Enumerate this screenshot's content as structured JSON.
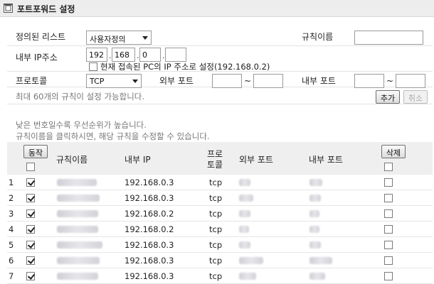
{
  "title": "포트포워드 설정",
  "form": {
    "defined_list_label": "정의된 리스트",
    "defined_list_value": "사용자정의",
    "rule_name_label": "규칙이름",
    "rule_name_value": "",
    "internal_ip_label": "내부 IP주소",
    "ip1": "192",
    "ip2": "168",
    "ip3": "0",
    "ip4": "",
    "use_current_pc_label": "현재 접속된 PC의 IP 주소로 설정(192.168.0.2)",
    "protocol_label": "프로토콜",
    "protocol_value": "TCP",
    "external_port_label": "외부 포트",
    "external_port_from": "",
    "external_port_to": "",
    "internal_port_label": "내부 포트",
    "internal_port_from": "",
    "internal_port_to": "",
    "tilde": "~",
    "max_rules_note": "최대 60개의 규칙이 설정 가능합니다.",
    "add_label": "추가",
    "cancel_label": "취소"
  },
  "notes": {
    "priority_note": "낮은 번호일수록 우선순위가 높습니다.",
    "edit_note": "규칙이름을 클릭하시면, 해당 규칙을 수정할 수 있습니다."
  },
  "table": {
    "action_btn": "동작",
    "col_rule_name": "규칙이름",
    "col_internal_ip": "내부 IP",
    "col_protocol_1": "프로",
    "col_protocol_2": "토콜",
    "col_external_port": "외부 포트",
    "col_internal_port": "내부 포트",
    "delete_btn": "삭제",
    "rows": [
      {
        "num": "1",
        "ip": "192.168.0.3",
        "proto": "tcp",
        "active": true,
        "delete": false
      },
      {
        "num": "2",
        "ip": "192.168.0.3",
        "proto": "tcp",
        "active": true,
        "delete": false
      },
      {
        "num": "3",
        "ip": "192.168.0.2",
        "proto": "tcp",
        "active": true,
        "delete": false
      },
      {
        "num": "4",
        "ip": "192.168.0.2",
        "proto": "tcp",
        "active": true,
        "delete": false
      },
      {
        "num": "5",
        "ip": "192.168.0.3",
        "proto": "tcp",
        "active": true,
        "delete": false
      },
      {
        "num": "6",
        "ip": "192.168.0.3",
        "proto": "tcp",
        "active": true,
        "delete": false
      },
      {
        "num": "7",
        "ip": "192.168.0.3",
        "proto": "tcp",
        "active": true,
        "delete": false
      }
    ]
  }
}
